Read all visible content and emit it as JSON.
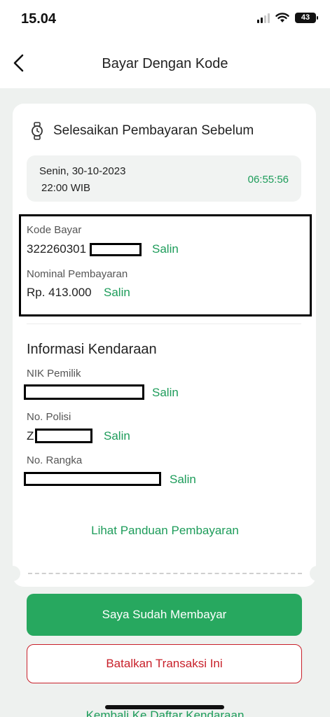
{
  "status_bar": {
    "time": "15.04",
    "battery": "43"
  },
  "header": {
    "title": "Bayar Dengan Kode"
  },
  "deadline": {
    "heading": "Selesaikan Pembayaran Sebelum",
    "date": "Senin, 30-10-2023",
    "time": "22:00 WIB",
    "countdown": "06:55:56"
  },
  "payment": {
    "code_label": "Kode Bayar",
    "code_value": "322260301",
    "amount_label": "Nominal Pembayaran",
    "amount_value": "Rp. 413.000",
    "copy_label": "Salin"
  },
  "vehicle": {
    "heading": "Informasi Kendaraan",
    "nik_label": "NIK Pemilik",
    "plate_label": "No. Polisi",
    "plate_value": "Z",
    "chassis_label": "No. Rangka"
  },
  "actions": {
    "guide_link": "Lihat Panduan Pembayaran",
    "paid_button": "Saya Sudah Membayar",
    "cancel_button": "Batalkan Transaksi Ini",
    "back_link": "Kembali Ke Daftar Kendaraan"
  },
  "colors": {
    "accent": "#1d9c5a",
    "primary_button": "#27a85f",
    "danger": "#c8202a"
  }
}
